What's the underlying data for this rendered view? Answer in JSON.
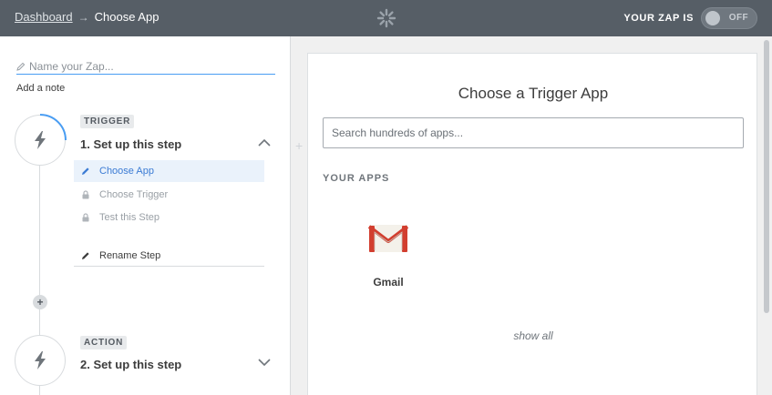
{
  "header": {
    "breadcrumb_root": "Dashboard",
    "breadcrumb_separator": "→",
    "breadcrumb_current": "Choose App",
    "status_label": "YOUR ZAP IS",
    "toggle_text": "OFF",
    "center_icon": "snowflake-spinner-icon"
  },
  "sidebar": {
    "name_placeholder": "Name your Zap...",
    "add_note": "Add a note",
    "trigger": {
      "tag": "TRIGGER",
      "title": "1. Set up this step",
      "substeps": [
        {
          "label": "Choose App",
          "icon": "pencil-icon",
          "state": "active"
        },
        {
          "label": "Choose Trigger",
          "icon": "lock-icon",
          "state": "locked"
        },
        {
          "label": "Test this Step",
          "icon": "lock-icon",
          "state": "locked"
        }
      ],
      "rename": "Rename Step"
    },
    "action": {
      "tag": "ACTION",
      "title": "2. Set up this step"
    }
  },
  "main": {
    "title": "Choose a Trigger App",
    "search_placeholder": "Search hundreds of apps...",
    "section_label": "YOUR APPS",
    "apps": [
      {
        "name": "Gmail",
        "icon": "gmail-icon"
      }
    ],
    "show_all": "show all"
  },
  "colors": {
    "topbar": "#565e66",
    "accent_blue": "#499df3",
    "active_text": "#3b7bd4",
    "gmail_red": "#d23e2f"
  }
}
